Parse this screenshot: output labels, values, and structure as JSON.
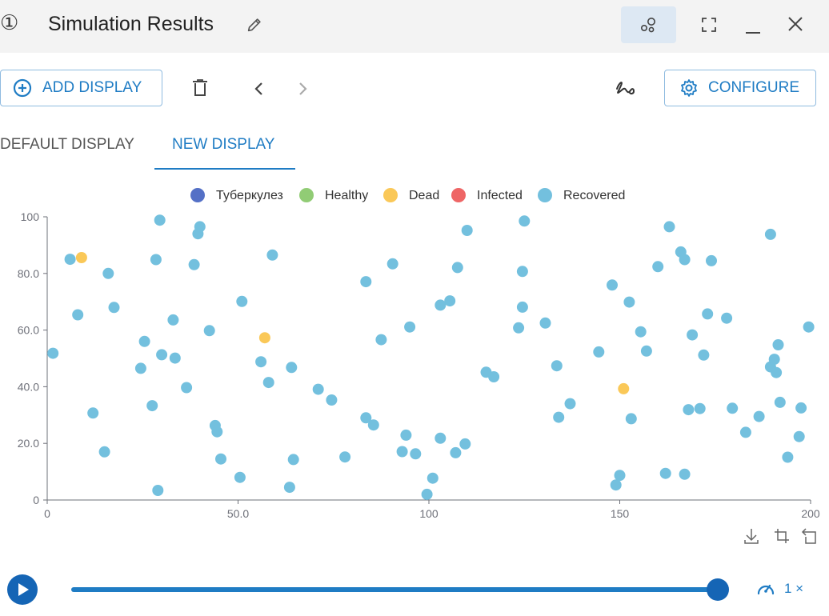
{
  "window": {
    "number": "①",
    "title": "Simulation Results"
  },
  "toolbar": {
    "add_display_label": "ADD DISPLAY",
    "configure_label": "CONFIGURE"
  },
  "tabs": [
    {
      "label": "DEFAULT DISPLAY",
      "active": false
    },
    {
      "label": "NEW DISPLAY",
      "active": true
    }
  ],
  "colors": {
    "accent": "#1f7cc4",
    "tuberculosis": "#5470c6",
    "healthy": "#91cc75",
    "dead": "#fac858",
    "infected": "#ee6666",
    "recovered": "#73c0de"
  },
  "icons": [
    "edit-icon",
    "visualization-icon",
    "fullscreen-icon",
    "minimize-icon",
    "close-icon",
    "add-circle-icon",
    "delete-icon",
    "chevron-left-icon",
    "chevron-right-icon",
    "signature-icon",
    "gear-icon",
    "download-icon",
    "zoom-icon",
    "restore-icon",
    "play-icon",
    "speedometer-icon"
  ],
  "playback": {
    "progress": 1.0,
    "speed_label": "1 ×"
  },
  "chart_data": {
    "type": "scatter",
    "legend_position": "top-center",
    "grid": false,
    "xlim": [
      0,
      200
    ],
    "ylim": [
      0,
      100
    ],
    "x_ticks": [
      {
        "value": 0,
        "label": "0"
      },
      {
        "value": 50,
        "label": "50.0"
      },
      {
        "value": 100,
        "label": "100"
      },
      {
        "value": 150,
        "label": "150"
      },
      {
        "value": 200,
        "label": "200"
      }
    ],
    "y_ticks": [
      {
        "value": 0,
        "label": "0"
      },
      {
        "value": 20,
        "label": "20.0"
      },
      {
        "value": 40,
        "label": "40.0"
      },
      {
        "value": 60,
        "label": "60.0"
      },
      {
        "value": 80,
        "label": "80.0"
      },
      {
        "value": 100,
        "label": "100"
      }
    ],
    "series": [
      {
        "name": "Туберкулез",
        "color": "#5470c6",
        "points": []
      },
      {
        "name": "Healthy",
        "color": "#91cc75",
        "points": []
      },
      {
        "name": "Dead",
        "color": "#fac858",
        "points": [
          [
            9.0,
            85.6
          ],
          [
            57.0,
            57.3
          ],
          [
            151.0,
            39.3
          ]
        ]
      },
      {
        "name": "Infected",
        "color": "#ee6666",
        "points": []
      },
      {
        "name": "Recovered",
        "color": "#73c0de",
        "points": [
          [
            1.5,
            51.8
          ],
          [
            6.0,
            85.0
          ],
          [
            8.0,
            65.4
          ],
          [
            12.0,
            30.7
          ],
          [
            15.0,
            17.0
          ],
          [
            16.0,
            80.0
          ],
          [
            17.5,
            68.0
          ],
          [
            24.5,
            46.5
          ],
          [
            25.5,
            56.0
          ],
          [
            27.5,
            33.3
          ],
          [
            28.5,
            84.9
          ],
          [
            29.0,
            3.4
          ],
          [
            29.5,
            98.8
          ],
          [
            30.0,
            51.3
          ],
          [
            33.0,
            63.6
          ],
          [
            33.5,
            50.1
          ],
          [
            36.5,
            39.7
          ],
          [
            38.5,
            83.1
          ],
          [
            39.5,
            94.0
          ],
          [
            40.0,
            96.5
          ],
          [
            42.5,
            59.8
          ],
          [
            44.0,
            26.3
          ],
          [
            44.5,
            24.1
          ],
          [
            45.5,
            14.5
          ],
          [
            50.5,
            8.0
          ],
          [
            51.0,
            70.1
          ],
          [
            56.0,
            48.8
          ],
          [
            58.0,
            41.5
          ],
          [
            59.0,
            86.5
          ],
          [
            63.5,
            4.5
          ],
          [
            64.0,
            46.8
          ],
          [
            64.5,
            14.3
          ],
          [
            71.0,
            39.1
          ],
          [
            74.5,
            35.3
          ],
          [
            78.0,
            15.2
          ],
          [
            83.5,
            77.1
          ],
          [
            83.5,
            29.0
          ],
          [
            85.5,
            26.5
          ],
          [
            87.5,
            56.6
          ],
          [
            90.5,
            83.4
          ],
          [
            93.0,
            17.1
          ],
          [
            94.0,
            22.9
          ],
          [
            95.0,
            61.1
          ],
          [
            96.5,
            16.3
          ],
          [
            99.5,
            2.0
          ],
          [
            101.0,
            7.7
          ],
          [
            103.0,
            21.8
          ],
          [
            103.0,
            68.8
          ],
          [
            105.5,
            70.3
          ],
          [
            107.0,
            16.7
          ],
          [
            107.5,
            82.1
          ],
          [
            109.5,
            19.8
          ],
          [
            110.0,
            95.2
          ],
          [
            115.0,
            45.1
          ],
          [
            117.0,
            43.5
          ],
          [
            123.5,
            60.8
          ],
          [
            124.5,
            80.7
          ],
          [
            124.5,
            68.1
          ],
          [
            125.0,
            98.5
          ],
          [
            130.5,
            62.5
          ],
          [
            133.5,
            47.4
          ],
          [
            134.0,
            29.2
          ],
          [
            137.0,
            34.0
          ],
          [
            144.5,
            52.3
          ],
          [
            148.0,
            75.9
          ],
          [
            149.0,
            5.3
          ],
          [
            150.0,
            8.7
          ],
          [
            152.5,
            69.9
          ],
          [
            153.0,
            28.7
          ],
          [
            155.5,
            59.4
          ],
          [
            157.0,
            52.6
          ],
          [
            160.0,
            82.4
          ],
          [
            162.0,
            9.4
          ],
          [
            163.0,
            96.5
          ],
          [
            166.0,
            87.6
          ],
          [
            167.0,
            84.9
          ],
          [
            167.0,
            9.1
          ],
          [
            168.0,
            31.9
          ],
          [
            169.0,
            58.3
          ],
          [
            171.0,
            32.3
          ],
          [
            172.0,
            51.2
          ],
          [
            173.0,
            65.7
          ],
          [
            174.0,
            84.5
          ],
          [
            178.0,
            64.2
          ],
          [
            179.5,
            32.4
          ],
          [
            183.0,
            23.9
          ],
          [
            186.5,
            29.5
          ],
          [
            189.5,
            93.8
          ],
          [
            189.5,
            47.0
          ],
          [
            190.5,
            49.7
          ],
          [
            191.0,
            45.0
          ],
          [
            191.5,
            54.8
          ],
          [
            192.0,
            34.5
          ],
          [
            194.0,
            15.1
          ],
          [
            197.0,
            22.4
          ],
          [
            197.5,
            32.5
          ],
          [
            199.5,
            61.1
          ]
        ]
      }
    ]
  }
}
